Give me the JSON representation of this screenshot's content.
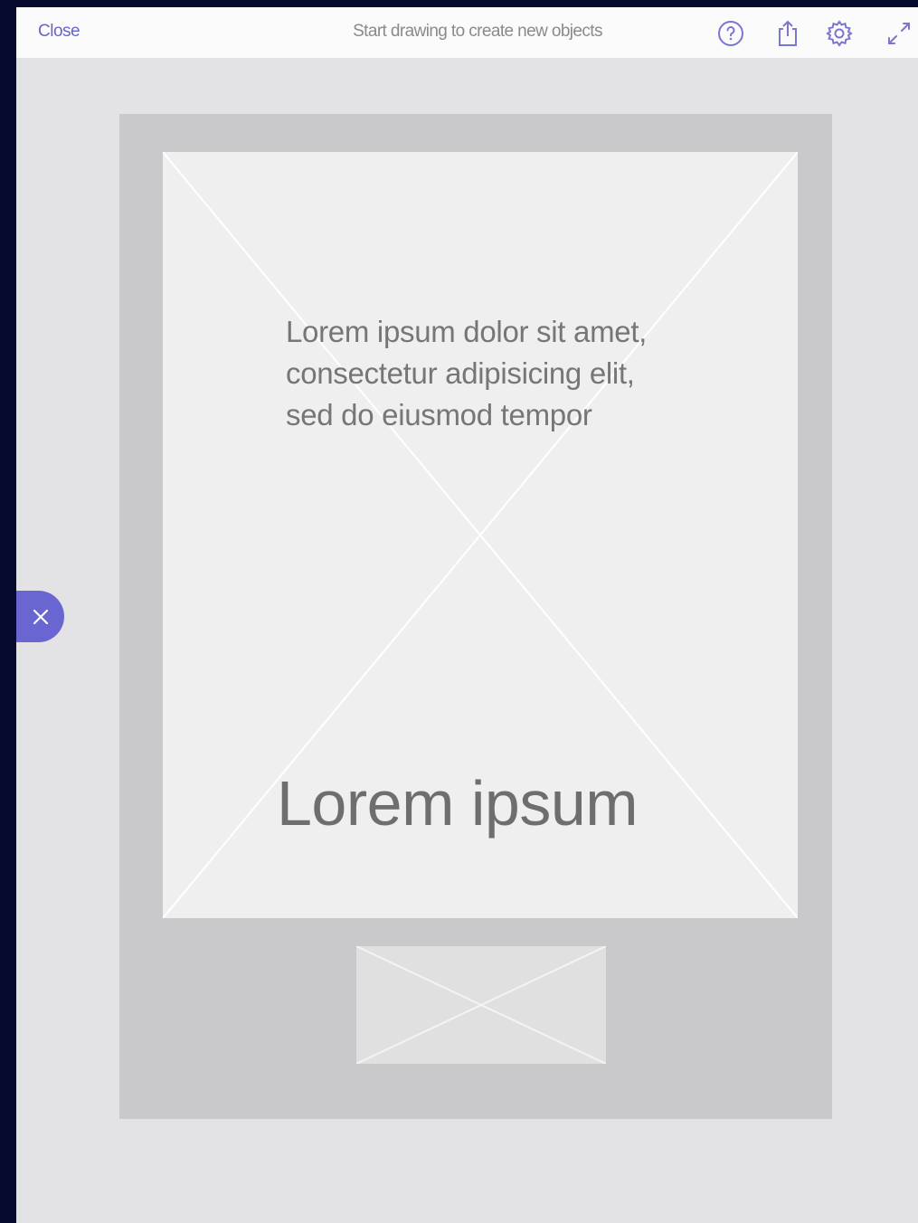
{
  "topbar": {
    "close_label": "Close",
    "hint": "Start drawing to create new objects",
    "icons": [
      "help-icon",
      "share-icon",
      "settings-icon",
      "expand-icon"
    ]
  },
  "canvas": {
    "body_text_lines": [
      "Lorem ipsum dolor sit amet,",
      "consectetur adipisicing elit,",
      "sed do eiusmod tempor"
    ],
    "headline": "Lorem ipsum"
  },
  "fab": {
    "icon": "close-icon"
  },
  "colors": {
    "accent": "#6a66d1",
    "link": "#6a64c8",
    "canvas_bg": "#e3e3e5",
    "artboard": "#c9c9cb",
    "placeholder": "#efefef",
    "side_frame": "#050a2e"
  }
}
